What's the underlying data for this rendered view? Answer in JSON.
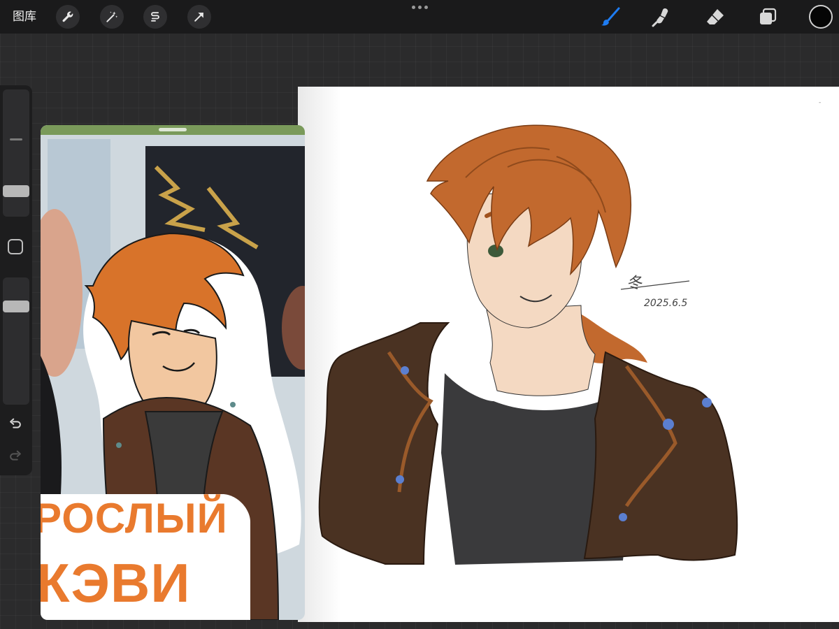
{
  "toolbar": {
    "gallery_label": "图库",
    "left_tools": [
      "wrench-icon",
      "magic-wand-icon",
      "selection-icon",
      "transform-arrow-icon"
    ],
    "right_tools": [
      "brush-icon",
      "smudge-icon",
      "eraser-icon",
      "layers-icon"
    ],
    "active_tool": "brush-icon",
    "accent_color": "#1e7cf2",
    "current_color": "#050505"
  },
  "sidebar": {
    "brush_size_level": 0.85,
    "opacity_level": 0.3
  },
  "reference": {
    "caption_line1": "РОСЛЫЙ",
    "caption_line2": "КЭВИ",
    "caption_color": "#e97a2e"
  },
  "canvas": {
    "signature": "冬",
    "date": "2025.6.5"
  }
}
